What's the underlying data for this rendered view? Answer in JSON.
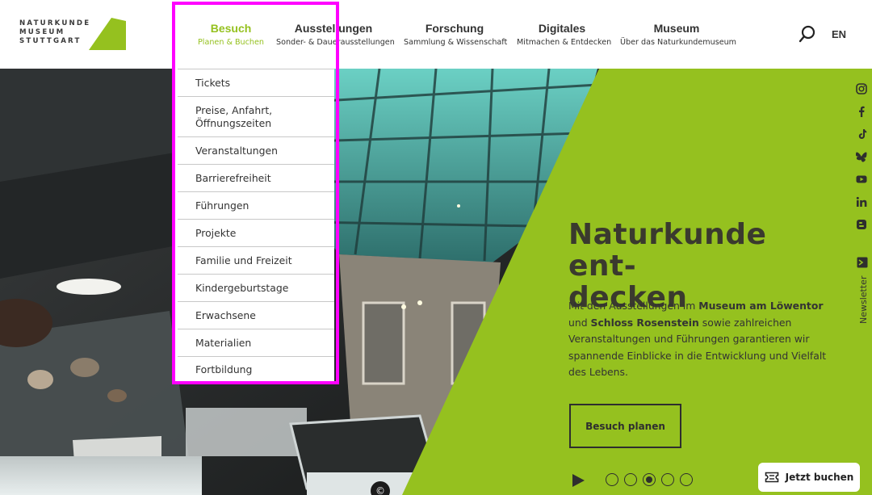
{
  "logo": {
    "lines": [
      "NATURKUNDE",
      "MUSEUM",
      "STUTTGART"
    ],
    "accent": "#95c11f"
  },
  "nav": [
    {
      "title": "Besuch",
      "sub": "Planen & Buchen",
      "active": true
    },
    {
      "title": "Ausstellungen",
      "sub": "Sonder- & Dauerausstellungen",
      "active": false
    },
    {
      "title": "Forschung",
      "sub": "Sammlung & Wissenschaft",
      "active": false
    },
    {
      "title": "Digitales",
      "sub": "Mitmachen & Entdecken",
      "active": false
    },
    {
      "title": "Museum",
      "sub": "Über das Naturkundemuseum",
      "active": false
    }
  ],
  "header": {
    "search_icon": "search-icon",
    "lang": "EN"
  },
  "dropdown": {
    "items": [
      "Tickets",
      "Preise, Anfahrt,\nÖffnungszeiten",
      "Veranstaltungen",
      "Barrierefreiheit",
      "Führungen",
      "Projekte",
      "Familie und Freizeit",
      "Kindergeburtstage",
      "Erwachsene",
      "Materialien",
      "Fortbildung"
    ]
  },
  "hero": {
    "heading_line1": "Naturkunde ent-",
    "heading_line2": "decken",
    "text_pre": "Mit den Ausstellungen im ",
    "text_b1": "Museum am Löwentor",
    "text_mid": " und ",
    "text_b2": "Schloss Rosenstein",
    "text_post": " sowie zahlreichen Veranstaltungen und Führungen garantieren wir spannende Einblicke in die Entwicklung und Vielfalt des Lebens.",
    "button": "Besuch planen",
    "copyright": "©",
    "slides": 5,
    "active_slide": 3,
    "green": "#95c11f"
  },
  "social": [
    "instagram-icon",
    "facebook-icon",
    "tiktok-icon",
    "bluesky-icon",
    "youtube-icon",
    "linkedin-icon",
    "blogger-icon"
  ],
  "newsletter": "Newsletter",
  "book": {
    "label": "Jetzt buchen"
  }
}
